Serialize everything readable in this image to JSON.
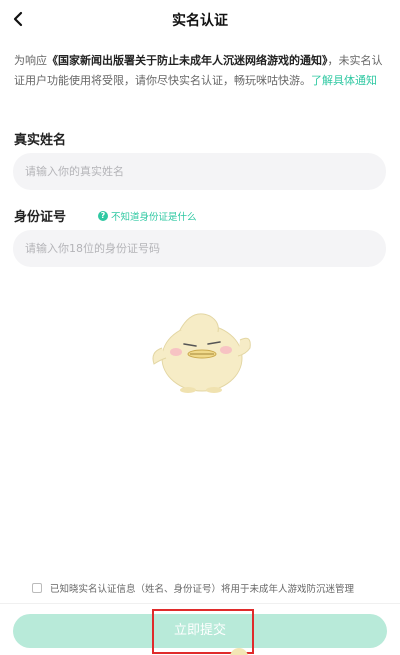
{
  "header": {
    "title": "实名认证"
  },
  "notice": {
    "intro": "为响应",
    "document": "《国家新闻出版署关于防止未成年人沉迷网络游戏的通知》",
    "body": "，未实名认证用户功能使用将受限，请你尽快实名认证，畅玩咪咕快游。",
    "link": "了解具体通知"
  },
  "form": {
    "name_label": "真实姓名",
    "name_placeholder": "请输入你的真实姓名",
    "name_value": "",
    "id_label": "身份证号",
    "id_help_icon": "?",
    "id_help": "不知道身份证是什么",
    "id_placeholder": "请输入你18位的身份证号码",
    "id_value": ""
  },
  "agreement": {
    "text": "已知晓实名认证信息（姓名、身份证号）将用于未成年人游戏防沉迷管理",
    "checked": false
  },
  "submit": {
    "label": "立即提交"
  },
  "colors": {
    "accent": "#2fc8a2",
    "button_disabled": "#b8ead9",
    "highlight": "#e02b2b",
    "input_bg": "#f4f4f6"
  },
  "icons": {
    "back": "chevron-left-icon",
    "help": "question-circle-icon",
    "mascot": "mascot-illustration"
  }
}
